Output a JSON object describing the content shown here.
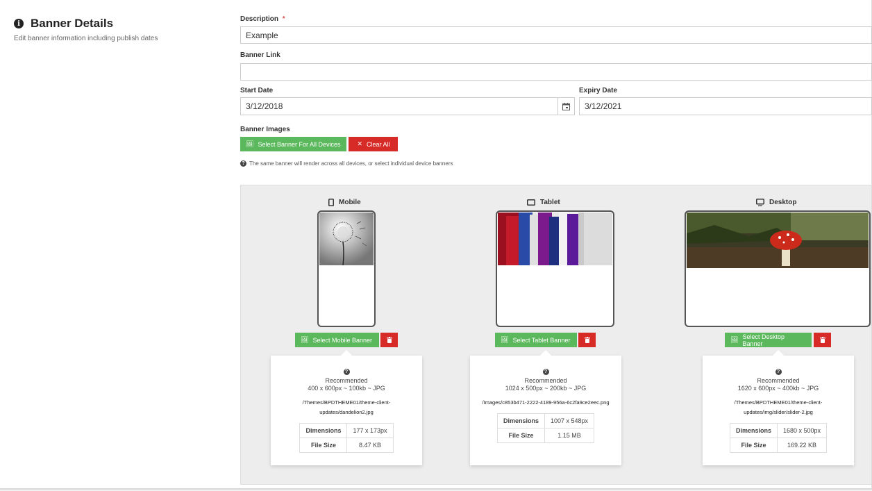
{
  "section": {
    "title": "Banner Details",
    "subtitle": "Edit banner information including publish dates"
  },
  "form": {
    "description_label": "Description",
    "required_mark": "*",
    "description_value": "Example",
    "banner_link_label": "Banner Link",
    "banner_link_value": "",
    "start_date_label": "Start Date",
    "start_date_value": "3/12/2018",
    "expiry_date_label": "Expiry Date",
    "expiry_date_value": "3/12/2021",
    "banner_images_label": "Banner Images",
    "select_all_label": "Select Banner For All Devices",
    "clear_all_label": "Clear All",
    "help_text": "The same banner will render across all devices, or select individual device banners"
  },
  "devices": [
    {
      "name": "Mobile",
      "select_label": "Select Mobile Banner",
      "recommended_label": "Recommended",
      "recommended": "400 x 600px ~ 100kb ~ JPG",
      "path": "/Themes/BPDTHEME01/theme-client-updates/dandelion2.jpg",
      "dimensions_label": "Dimensions",
      "dimensions": "177 x 173px",
      "file_size_label": "File Size",
      "file_size": "8.47 KB"
    },
    {
      "name": "Tablet",
      "select_label": "Select Tablet Banner",
      "recommended_label": "Recommended",
      "recommended": "1024 x 500px ~ 200kb ~ JPG",
      "path": "/Images/c853b471-2222-4189-956a-6c2fa9ce2eec.png",
      "dimensions_label": "Dimensions",
      "dimensions": "1007 x 548px",
      "file_size_label": "File Size",
      "file_size": "1.15 MB"
    },
    {
      "name": "Desktop",
      "select_label": "Select Desktop Banner",
      "recommended_label": "Recommended",
      "recommended": "1620 x 600px ~ 400kb ~ JPG",
      "path": "/Themes/BPDTHEME01/theme-client-updates/img/slider/slider-2.jpg",
      "dimensions_label": "Dimensions",
      "dimensions": "1680 x 500px",
      "file_size_label": "File Size",
      "file_size": "169.22 KB"
    }
  ],
  "colors": {
    "green": "#5cb85c",
    "red": "#d62b27",
    "panel": "#ededed"
  }
}
